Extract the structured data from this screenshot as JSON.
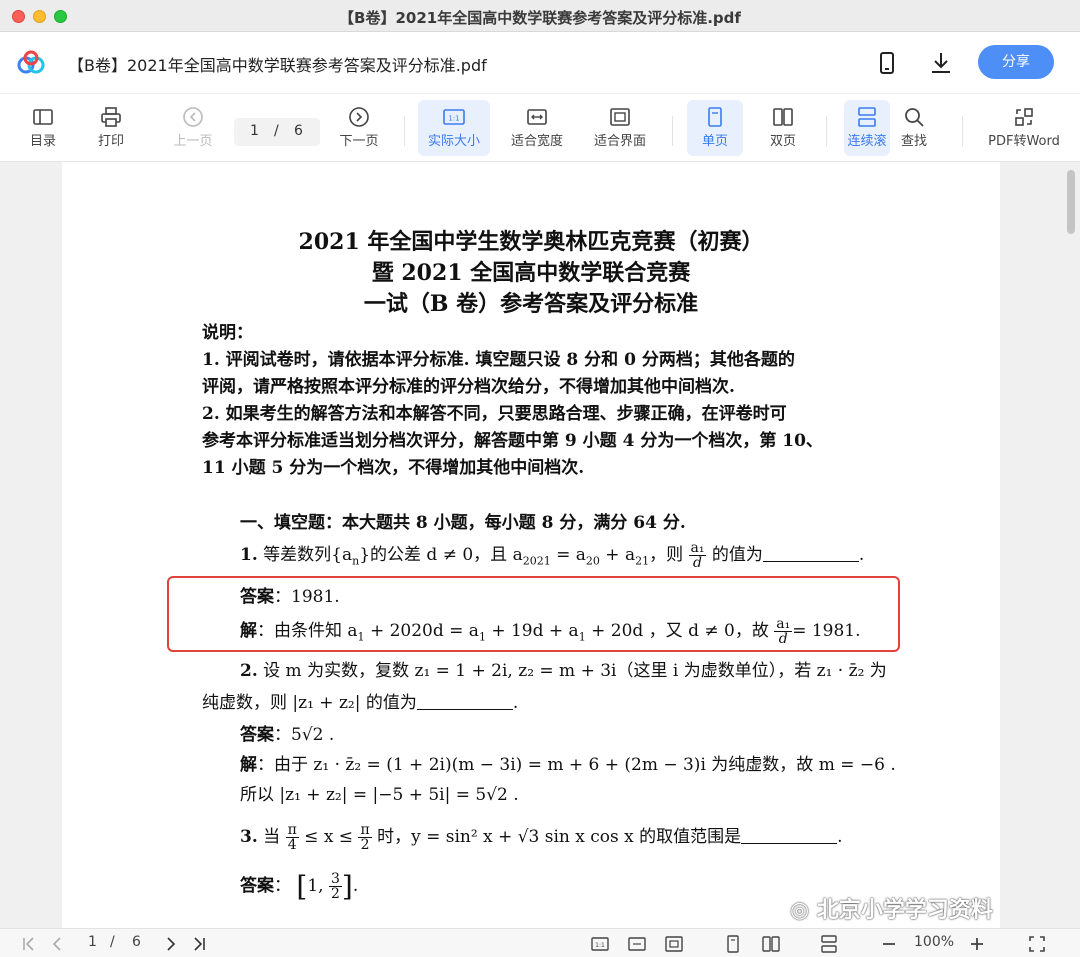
{
  "window": {
    "title": "【B卷】2021年全国高中数学联赛参考答案及评分标准.pdf"
  },
  "header": {
    "doc_name": "【B卷】2021年全国高中数学联赛参考答案及评分标准.pdf",
    "share_label": "分享"
  },
  "toolbar": {
    "toc": "目录",
    "print": "打印",
    "prev": "上一页",
    "page_current": "1",
    "page_sep": "/",
    "page_total": "6",
    "next": "下一页",
    "actual_size": "实际大小",
    "fit_width": "适合宽度",
    "fit_window": "适合界面",
    "single": "单页",
    "double": "双页",
    "continuous": "连续滚",
    "find": "查找",
    "pdf_word": "PDF转Word"
  },
  "document": {
    "title1": "2021 年全国中学生数学奥林匹克竞赛（初赛）",
    "title2": "暨 2021 全国高中数学联合竞赛",
    "title3": "一试（B 卷）参考答案及评分标准",
    "note_head": "说明：",
    "note1a": "1.  评阅试卷时，请依据本评分标准. 填空题只设 8 分和 0 分两档；其他各题的",
    "note1b": "评阅，请严格按照本评分标准的评分档次给分，不得增加其他中间档次.",
    "note2a": "2.  如果考生的解答方法和本解答不同，只要思路合理、步骤正确，在评卷时可",
    "note2b": "参考本评分标准适当划分档次评分，解答题中第 9 小题 4 分为一个档次，第 10、",
    "note2c": "11 小题 5 分为一个档次，不得增加其他中间档次.",
    "section1": "一、填空题：本大题共 8 小题，每小题 8 分，满分 64 分.",
    "q1_num": "1.",
    "q1_a": "等差数列{a",
    "q1_b": "}的公差 d ≠ 0，且 a",
    "q1_c": " = a",
    "q1_d": " + a",
    "q1_e": "，则",
    "q1_f": "的值为",
    "q1_end": ".",
    "sub_n": "n",
    "sub_2021": "2021",
    "sub_20": "20",
    "sub_21": "21",
    "sub_1": "1",
    "frac_a1": "a₁",
    "frac_d": "d",
    "ans_label": "答案",
    "sol_label": "解",
    "colon": "：",
    "ans1": "1981.",
    "sol1_a": "由条件知 a",
    "sol1_b": " + 2020d = a",
    "sol1_c": " + 19d + a",
    "sol1_d": " + 20d ，又 d ≠ 0，故",
    "sol1_e": "= 1981.",
    "q2_a": "设 m 为实数，复数 z₁ = 1 + 2i, z₂ = m + 3i（这里 i 为虚数单位），若 z₁ · z̄₂ 为",
    "q2_b": "纯虚数，则 |z₁ + z₂| 的值为",
    "q2_num": "2.",
    "ans2": "5√2 .",
    "sol2_a": "由于 z₁ · z̄₂ = (1 + 2i)(m − 3i) = m + 6 + (2m − 3)i 为纯虚数，故 m = −6 .",
    "sol2_b": "所以 |z₁ + z₂| = |−5 + 5i| = 5√2 .",
    "q3_num": "3.",
    "q3_a": "当",
    "q3_pi": "π",
    "q3_4": "4",
    "q3_2": "2",
    "q3_b": "≤ x ≤",
    "q3_c": "时，y = sin² x + √3 sin x cos x 的取值范围是",
    "ans3_a": "1,",
    "ans3_n": "3",
    "ans3_d": "2",
    "watermark": "北京小学学习资料"
  },
  "bottombar": {
    "page_current": "1",
    "page_sep": "/",
    "page_total": "6",
    "zoom": "100%"
  }
}
